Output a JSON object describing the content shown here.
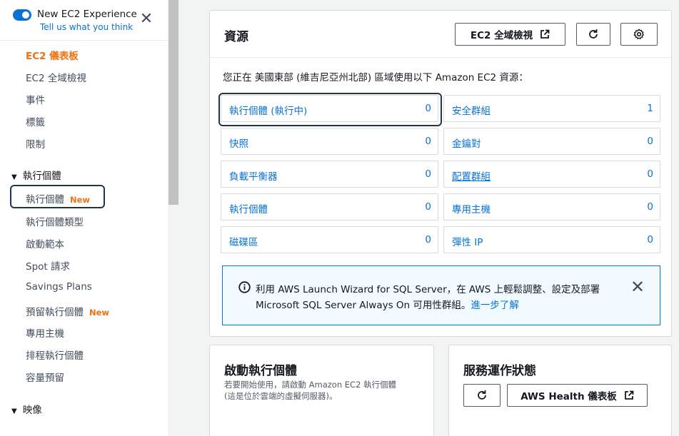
{
  "sidebar": {
    "toggle_title": "New EC2 Experience",
    "toggle_subtitle": "Tell us what you think",
    "items": [
      {
        "label": "EC2 儀表板"
      },
      {
        "label": "EC2 全域檢視"
      },
      {
        "label": "事件"
      },
      {
        "label": "標籤"
      },
      {
        "label": "限制"
      }
    ],
    "section_instances": "執行個體",
    "instance_items": [
      {
        "label": "執行個體",
        "badge": "New"
      },
      {
        "label": "執行個體類型"
      },
      {
        "label": "啟動範本"
      },
      {
        "label": "Spot 請求"
      },
      {
        "label": "Savings Plans"
      },
      {
        "label": "預留執行個體",
        "badge": "New"
      },
      {
        "label": "專用主機"
      },
      {
        "label": "排程執行個體"
      },
      {
        "label": "容量預留"
      }
    ],
    "section_images": "映像"
  },
  "resources": {
    "title": "資源",
    "global_view_button": "EC2 全域檢視",
    "region_note": "您正在 美國東部 (維吉尼亞州北部) 區域使用以下 Amazon EC2 資源：",
    "cards": [
      {
        "label": "執行個體 (執行中)",
        "count": "0"
      },
      {
        "label": "安全群組",
        "count": "1"
      },
      {
        "label": "快照",
        "count": "0"
      },
      {
        "label": "金鑰對",
        "count": "0"
      },
      {
        "label": "負載平衡器",
        "count": "0"
      },
      {
        "label": "配置群組",
        "count": "0"
      },
      {
        "label": "執行個體",
        "count": "0"
      },
      {
        "label": "專用主機",
        "count": "0"
      },
      {
        "label": "磁碟區",
        "count": "0"
      },
      {
        "label": "彈性 IP",
        "count": "0"
      }
    ],
    "info": {
      "line1": "利用 AWS Launch Wizard for SQL Server，在 AWS 上輕鬆調整、設定及部署",
      "line2": "Microsoft SQL Server Always On 可用性群組。",
      "link": "進一步了解"
    }
  },
  "launch": {
    "title": "啟動執行個體",
    "desc_line1": "若要開始使用，請啟動 Amazon EC2 執行個體",
    "desc_line2": "(這是位於雲端的虛擬伺服器)。"
  },
  "service_health": {
    "title": "服務運作狀態",
    "dashboard_button": "AWS Health 儀表板"
  },
  "colors": {
    "accent": "#ec7211",
    "link": "#0972d3",
    "highlight": "#24344d"
  }
}
